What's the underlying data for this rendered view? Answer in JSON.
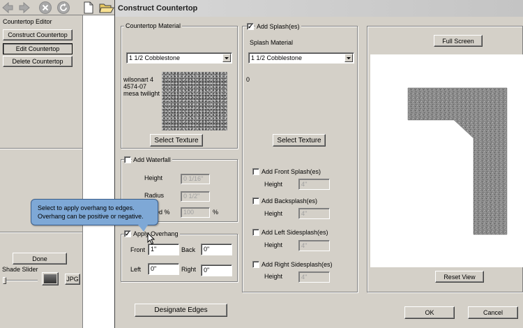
{
  "window": {
    "title": "Construct Countertop"
  },
  "editor": {
    "title": "Countertop Editor",
    "construct_label": "Construct Countertop",
    "edit_label": "Edit Countertop",
    "delete_label": "Delete Countertop",
    "done_label": "Done",
    "shade_slider_label": "Shade Slider",
    "jpg_label": "JPG"
  },
  "tooltip": {
    "line1": "Select to apply overhang to edges.",
    "line2": "Overhang can be positive or negative."
  },
  "countertop_material": {
    "title": "Countertop Material",
    "selected": "1 1/2 Cobblestone",
    "info_line1": "wilsonart 4",
    "info_line2": "4574-07",
    "info_line3": "mesa twilight",
    "select_texture": "Select Texture"
  },
  "waterfall": {
    "label": "Add Waterfall",
    "checked": false,
    "height_label": "Height",
    "height_value": "0 1/16\"",
    "radius_label": "Radius",
    "radius_value": "0 1/2\"",
    "speed_label": "Speed %",
    "speed_value": "100",
    "percent": "%"
  },
  "overhang": {
    "label": "Apply Overhang",
    "checked": true,
    "front_label": "Front",
    "front_value": "1\"",
    "back_label": "Back",
    "back_value": "0\"",
    "left_label": "Left",
    "left_value": "0\"",
    "right_label": "Right",
    "right_value": "0\""
  },
  "splash": {
    "title": "Add Splash(es)",
    "checked": true,
    "material_label": "Splash Material",
    "selected": "1 1/2 Cobblestone",
    "info": "0",
    "select_texture": "Select Texture",
    "front_label": "Add Front Splash(es)",
    "back_label": "Add Backsplash(es)",
    "left_label": "Add Left Sidesplash(es)",
    "right_label": "Add Right Sidesplash(es)",
    "height_label": "Height",
    "height_value": "4\""
  },
  "preview": {
    "full_screen": "Full Screen",
    "reset_view": "Reset View"
  },
  "footer": {
    "designate_edges": "Designate Edges",
    "ok": "OK",
    "cancel": "Cancel"
  },
  "colors": {
    "title_gradient_start": "#d8d8d8",
    "dialog_bg": "#d4d0c8",
    "tooltip_bg": "#7ea8d6"
  },
  "icons": [
    "back-arrow-icon",
    "forward-arrow-icon",
    "stop-icon",
    "refresh-icon",
    "new-document-icon",
    "open-folder-icon"
  ]
}
